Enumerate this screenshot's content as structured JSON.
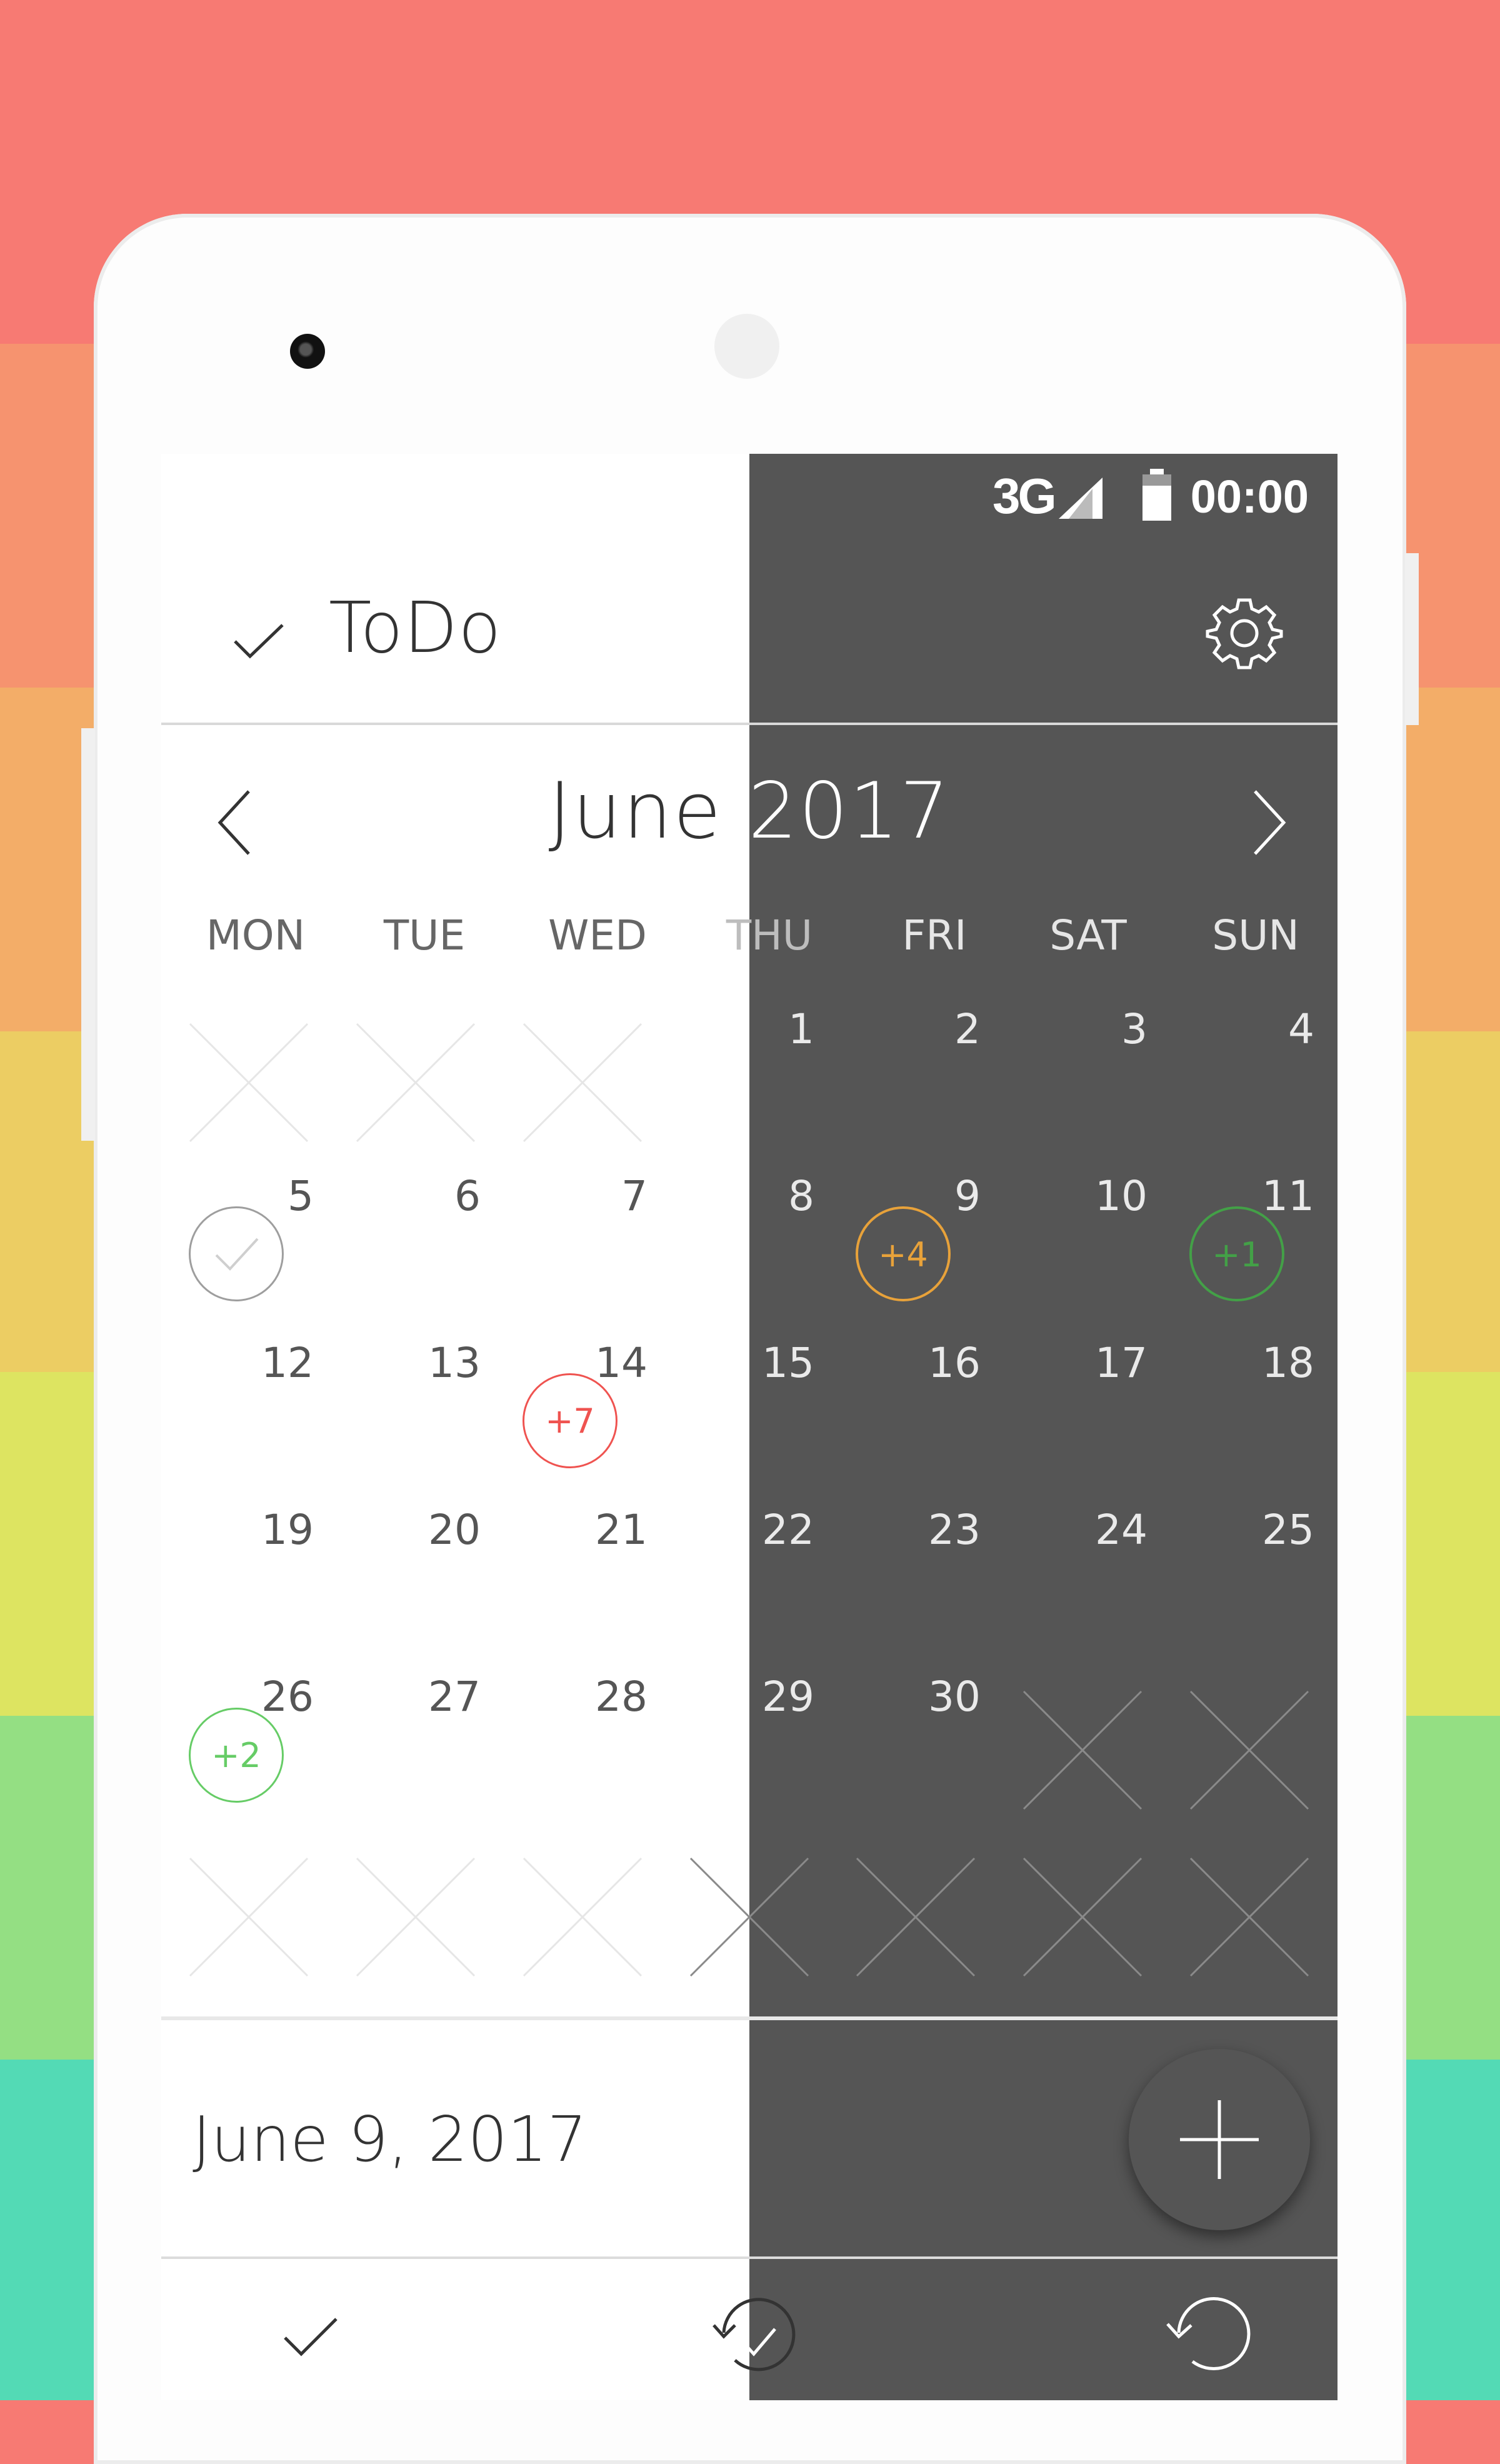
{
  "colors": {
    "bands": [
      "#f77a73",
      "#f6936f",
      "#f3ad68",
      "#eccd63",
      "#dde461",
      "#94df83",
      "#53dab5"
    ],
    "screen_dark": "#555555",
    "badge_orange": "#e8a23a",
    "badge_green_dark": "#43a047",
    "badge_red": "#ef5350",
    "badge_green": "#66cc66"
  },
  "status_bar": {
    "network": "3G",
    "time": "00:00",
    "icons": [
      "signal-icon",
      "battery-icon"
    ]
  },
  "app_bar": {
    "title": "ToDo",
    "left_icon": "check-icon",
    "right_icon": "gear-icon"
  },
  "calendar": {
    "month_label_a": "June",
    "month_label_b": "2017",
    "prev_icon": "chevron-left-icon",
    "next_icon": "chevron-right-icon",
    "weekdays": [
      "MON",
      "TUE",
      "WED",
      "THU",
      "FRI",
      "SAT",
      "SUN"
    ],
    "weeks": [
      [
        "",
        "",
        "",
        "1",
        "2",
        "3",
        "4"
      ],
      [
        "5",
        "6",
        "7",
        "8",
        "9",
        "10",
        "11"
      ],
      [
        "12",
        "13",
        "14",
        "15",
        "16",
        "17",
        "18"
      ],
      [
        "19",
        "20",
        "21",
        "22",
        "23",
        "24",
        "25"
      ],
      [
        "26",
        "27",
        "28",
        "29",
        "30",
        "",
        ""
      ],
      [
        "",
        "",
        "",
        "",
        "",
        "",
        ""
      ]
    ],
    "badges": {
      "day_5": {
        "type": "done",
        "icon": "check-icon"
      },
      "day_9": {
        "label": "+4",
        "color": "orange"
      },
      "day_11": {
        "label": "+1",
        "color": "green-dark"
      },
      "day_14": {
        "label": "+7",
        "color": "red"
      },
      "day_26": {
        "label": "+2",
        "color": "green"
      }
    }
  },
  "selected": {
    "date_label": "June 9, 2017"
  },
  "fab": {
    "icon": "plus-icon"
  },
  "bottom_nav": {
    "items": [
      "check-icon",
      "history-check-icon",
      "undo-icon"
    ]
  }
}
